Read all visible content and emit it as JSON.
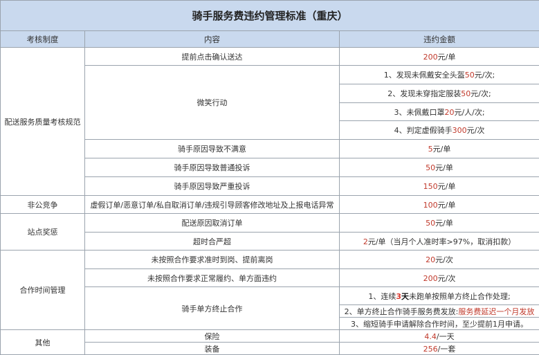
{
  "title": "骑手服务费违约管理标准（重庆）",
  "headers": [
    "考核制度",
    "内容",
    "违约金额"
  ],
  "rows": [
    {
      "category": "配送服务质量考核规范",
      "span": 8,
      "content": "提前点击确认送达",
      "amount": [
        {
          "t": "200",
          "c": "red"
        },
        {
          "t": "元/单",
          "c": ""
        }
      ]
    },
    {
      "content": "微笑行动",
      "cspan": 4,
      "amount": [
        {
          "t": "1、发现未佩戴安全头盔",
          "c": ""
        },
        {
          "t": "50",
          "c": "red"
        },
        {
          "t": "元/次;",
          "c": ""
        }
      ]
    },
    {
      "amount": [
        {
          "t": "2、发现未穿指定服装",
          "c": ""
        },
        {
          "t": "50",
          "c": "red"
        },
        {
          "t": "元/次;",
          "c": ""
        }
      ]
    },
    {
      "amount": [
        {
          "t": "3、未佩戴口罩",
          "c": ""
        },
        {
          "t": "20",
          "c": "red"
        },
        {
          "t": "元/人/次;",
          "c": ""
        }
      ]
    },
    {
      "amount": [
        {
          "t": "4、判定虚假骑手",
          "c": ""
        },
        {
          "t": "300",
          "c": "red"
        },
        {
          "t": "元/次",
          "c": ""
        }
      ]
    },
    {
      "content": "骑手原因导致不满意",
      "amount": [
        {
          "t": "5",
          "c": "red"
        },
        {
          "t": "元/单",
          "c": ""
        }
      ]
    },
    {
      "content": "骑手原因导致普通投诉",
      "amount": [
        {
          "t": "50",
          "c": "red"
        },
        {
          "t": "元/单",
          "c": ""
        }
      ]
    },
    {
      "content": "骑手原因导致严重投诉",
      "amount": [
        {
          "t": "150",
          "c": "red"
        },
        {
          "t": "元/单",
          "c": ""
        }
      ]
    },
    {
      "category": "非公竞争",
      "span": 1,
      "content": "虚假订单/恶意订单/私自取消订单/违规引导顾客修改地址及上报电话异常",
      "amount": [
        {
          "t": "100",
          "c": "red"
        },
        {
          "t": "元/单",
          "c": ""
        }
      ]
    },
    {
      "category": "站点奖惩",
      "span": 2,
      "content": "配送原因取消订单",
      "amount": [
        {
          "t": "50",
          "c": "red"
        },
        {
          "t": "元/单",
          "c": ""
        }
      ]
    },
    {
      "content": "超时合严超",
      "amount": [
        {
          "t": "2",
          "c": "red"
        },
        {
          "t": "元/单（当月个人准时率>97%，取消扣款）",
          "c": ""
        }
      ]
    },
    {
      "category": "合作时间管理",
      "span": 5,
      "content": "未按照合作要求准时到岗、提前离岗",
      "amount": [
        {
          "t": "20",
          "c": "red"
        },
        {
          "t": "元/次",
          "c": ""
        }
      ]
    },
    {
      "content": "未按照合作要求正常履约、单方面违约",
      "amount": [
        {
          "t": "200",
          "c": "red"
        },
        {
          "t": "元/次",
          "c": ""
        }
      ]
    },
    {
      "content": "骑手单方终止合作",
      "cspan": 3,
      "amount": [
        {
          "t": "1、连续",
          "c": ""
        },
        {
          "t": "3",
          "c": "redb"
        },
        {
          "t": "天",
          "c": "bold"
        },
        {
          "t": "未跑单按照单方终止合作处理;",
          "c": ""
        }
      ]
    },
    {
      "amount": [
        {
          "t": "2、单方终止合作骑手服务费发放:",
          "c": ""
        },
        {
          "t": "服务费延迟一个月发放",
          "c": "red"
        }
      ]
    },
    {
      "amount": [
        {
          "t": "3、缩短骑手申请解除合作时间，至少提前1月申请。",
          "c": ""
        }
      ]
    },
    {
      "category": "其他",
      "span": 2,
      "content": "保险",
      "amount": [
        {
          "t": "4.4",
          "c": "red"
        },
        {
          "t": "/一天",
          "c": ""
        }
      ]
    },
    {
      "content": "装备",
      "amount": [
        {
          "t": "256",
          "c": "red"
        },
        {
          "t": "/一套",
          "c": ""
        }
      ]
    }
  ]
}
